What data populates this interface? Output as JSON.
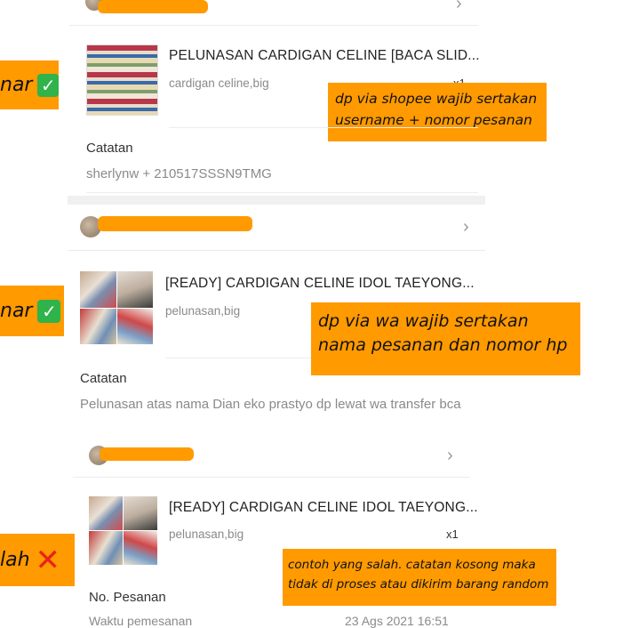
{
  "order1": {
    "product_title": "PELUNASAN CARDIGAN CELINE [BACA SLID...",
    "variant": "cardigan celine,big",
    "qty": "x1",
    "note_label": "Catatan",
    "note_text": "sherlynw + 210517SSSN9TMG",
    "callout": "dp via shopee wajib sertakan username + nomor pesanan",
    "side_tag": "nar"
  },
  "order2": {
    "product_title": "[READY] CARDIGAN CELINE IDOL TAEYONG...",
    "variant": "pelunasan,big",
    "note_label": "Catatan",
    "note_text": "Pelunasan atas nama Dian eko prastyo dp lewat wa transfer bca",
    "callout": "dp via wa wajib sertakan nama pesanan dan nomor hp",
    "side_tag": "nar"
  },
  "order3": {
    "product_title": "[READY] CARDIGAN CELINE IDOL TAEYONG...",
    "variant": "pelunasan,big",
    "qty": "x1",
    "order_no_label": "No. Pesanan",
    "order_time_label": "Waktu pemesanan",
    "order_time_value": "23 Ags 2021 16:51",
    "callout": "contoh yang salah. catatan kosong maka tidak di proses atau dikirim barang random",
    "side_tag": "lah"
  },
  "icons": {
    "chevron": "›",
    "check": "✓",
    "cross": "✕"
  },
  "colors": {
    "highlight": "#ff9a00",
    "check_green": "#2fb34a",
    "cross_red": "#e8231c"
  }
}
